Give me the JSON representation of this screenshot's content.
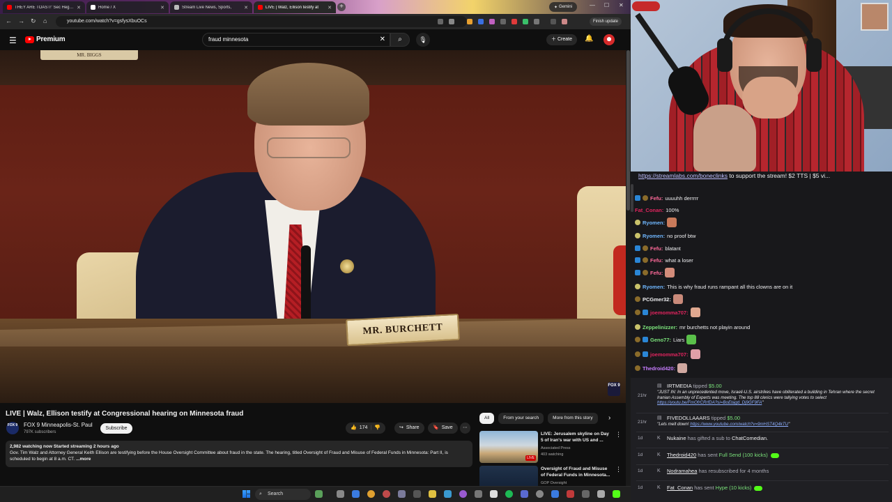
{
  "browser": {
    "tabs": [
      {
        "label": "THEY ARE TOAST!' Sec Hegset",
        "color": "#ff0000"
      },
      {
        "label": "Home / X",
        "color": "#ffffff"
      },
      {
        "label": "Stream Live News, Sports,",
        "color": "#cccccc"
      },
      {
        "label": "LIVE | Walz, Ellison testify at",
        "color": "#ff0000"
      }
    ],
    "gemini_label": "Gemini",
    "url": "youtube.com/watch?v=gsfysXbuOCs",
    "finish_update": "Finish update"
  },
  "youtube": {
    "logo_text": "Premium",
    "search_value": "fraud minnesota",
    "create_label": "Create",
    "video": {
      "old_plate": "MR. BIGGS",
      "nameplate": "MR. BURCHETT",
      "corner_bug": "FOX 9"
    },
    "title": "LIVE | Walz, Ellison testify at Congressional hearing on Minnesota fraud",
    "channel": {
      "name": "FOX 9 Minneapolis-St. Paul",
      "subs": "797K subscribers",
      "avatar_text": "FOX 9",
      "subscribe_label": "Subscribe"
    },
    "actions": {
      "likes": "174",
      "share": "Share",
      "save": "Save"
    },
    "description": {
      "stats": "2,982 watching now  Started streaming 2 hours ago",
      "text": "Gov. Tim Walz and Attorney General Keith Ellison are testifying before the House Oversight Committee about fraud in the state. The hearing, titled Oversight of Fraud and Misuse of Federal Funds in Minnesota: Part II, is scheduled to begin at 8 a.m. CT.",
      "more": "...more"
    },
    "chips": [
      "All",
      "From your search",
      "More from this story"
    ],
    "recommendations": [
      {
        "title": "LIVE: Jerusalem skyline on Day 5 of Iran's war with US and ...",
        "channel": "Associated Press",
        "meta": "403 watching",
        "badge": "LIVE"
      },
      {
        "title": "Oversight of Fraud and Misuse of Federal Funds in Minnesota...",
        "channel": "GOP Oversight",
        "meta": "",
        "badge": ""
      }
    ]
  },
  "stream": {
    "marquee": {
      "link": "https://streamlabs.com/boneclinks",
      "text": " to support the stream! $2 TTS | $5 vi..."
    },
    "chat": [
      {
        "user": "Fefu:",
        "text": "uuuuhh derrrrr",
        "color": "#ff6a9a",
        "badges": [
          "prime",
          "bits"
        ],
        "emote": ""
      },
      {
        "user": "Fat_Conan:",
        "text": "100%",
        "color": "#e0245e",
        "badges": [],
        "emote": ""
      },
      {
        "user": "Ryomen:",
        "text": "",
        "color": "#6fb7ff",
        "badges": [
          "wave"
        ],
        "emote": "#c97a5a"
      },
      {
        "user": "Ryomen:",
        "text": "no proof btw",
        "color": "#6fb7ff",
        "badges": [
          "wave"
        ],
        "emote": ""
      },
      {
        "user": "Fefu:",
        "text": "blatant",
        "color": "#ff6a9a",
        "badges": [
          "prime",
          "bits"
        ],
        "emote": ""
      },
      {
        "user": "Fefu:",
        "text": "what a loser",
        "color": "#ff6a9a",
        "badges": [
          "prime",
          "bits"
        ],
        "emote": ""
      },
      {
        "user": "Fefu:",
        "text": "",
        "color": "#ff6a9a",
        "badges": [
          "prime",
          "bits"
        ],
        "emote": "#d38c7a"
      },
      {
        "user": "Ryomen:",
        "text": "This is why fraud runs rampant all this clowns are on it",
        "color": "#6fb7ff",
        "badges": [
          "wave"
        ],
        "emote": ""
      },
      {
        "user": "PCGmer32:",
        "text": "",
        "color": "#efeff1",
        "badges": [
          "bits"
        ],
        "emote": "#c98a7a"
      },
      {
        "user": "joemomma707:",
        "text": "",
        "color": "#e0245e",
        "badges": [
          "bits",
          "prime"
        ],
        "emote": "#e0a890"
      },
      {
        "user": "Zeppelinizzer:",
        "text": "mr burchetts not playin around",
        "color": "#7be37b",
        "badges": [
          "wave"
        ],
        "emote": ""
      },
      {
        "user": "Geno77:",
        "text": "Liars",
        "color": "#7be37b",
        "badges": [
          "bits",
          "prime"
        ],
        "emote": "#5ac04a"
      },
      {
        "user": "joemomma707:",
        "text": "",
        "color": "#e0245e",
        "badges": [
          "bits",
          "prime"
        ],
        "emote": "#e0a0a8"
      },
      {
        "user": "Thedroid420:",
        "text": "",
        "color": "#c77dff",
        "badges": [
          "bits"
        ],
        "emote": "#d0a8a0"
      }
    ],
    "events": [
      {
        "time": "21hr",
        "user": "IRTMEDIA",
        "action": "tipped",
        "amount": "$5.00",
        "message_pre": "\"JUST IN: In an unprecedented move, Israeli-U.S. airstrikes have obliterated a building in Tehran where the secret Iranian Assembly of Experts was meeting. The top 88 clerics were tallying votes to select ",
        "message_link": "https://youtu.be/FmOfrCRrfDA?si=BoEtagd_Dj9GF9FA",
        "message_post": "\""
      },
      {
        "time": "21hr",
        "user": "FIVEDOLLAAARS",
        "action": "tipped",
        "amount": "$5.00",
        "message_pre": "\"Lets melt down! ",
        "message_link": "https://www.youtube.com/watch?v=9mHST4Q4kTU",
        "message_post": "\""
      },
      {
        "time": "1d",
        "user": "Nukaine",
        "action": "has gifted a sub to",
        "target": "ChatComedian."
      },
      {
        "time": "1d",
        "user": "Thedroid420",
        "action": "has sent",
        "target": "Full Send (100 kicks)"
      },
      {
        "time": "1d",
        "user": "Nodramahea",
        "action": "has resubscribed for 4 months"
      },
      {
        "time": "1d",
        "user": "Fat_Conan",
        "action": "has sent",
        "target": "Hype (10 kicks)"
      }
    ]
  },
  "taskbar": {
    "search_label": "Search"
  }
}
